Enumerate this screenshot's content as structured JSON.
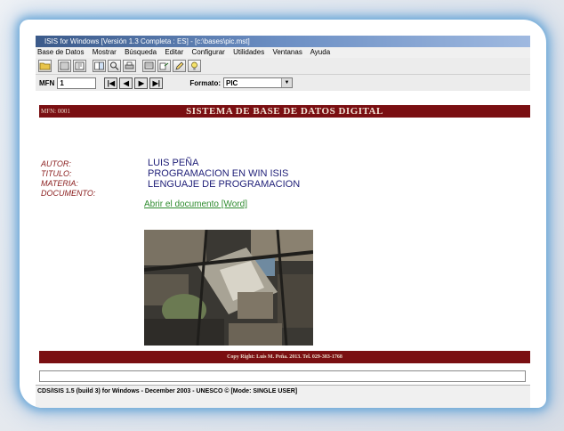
{
  "window": {
    "title": "ISIS for Windows [Versión 1.3 Completa : ES] - [c:\\bases\\pic.mst]"
  },
  "menubar": {
    "items": [
      "Base de Datos",
      "Mostrar",
      "Búsqueda",
      "Editar",
      "Configurar",
      "Utilidades",
      "Ventanas",
      "Ayuda"
    ]
  },
  "toolbar": {
    "icons": [
      "open-folder-icon",
      "database-icon",
      "index-icon",
      "browse-icon",
      "search-icon",
      "print-icon",
      "display-icon",
      "export-icon",
      "edit-pencil-icon",
      "help-bulb-icon"
    ]
  },
  "navbar": {
    "mfn_label": "MFN",
    "mfn_value": "1",
    "first_glyph": "|◀",
    "prev_glyph": "◀",
    "next_glyph": "▶",
    "last_glyph": "▶|",
    "format_label": "Formato:",
    "format_value": "PIC"
  },
  "record": {
    "banner_mfn": "MFN: 0001",
    "banner_title": "SISTEMA DE BASE DE DATOS DIGITAL",
    "fields": [
      {
        "label": "AUTOR:",
        "value": "LUIS PEÑA"
      },
      {
        "label": "TITULO:",
        "value": "PROGRAMACION EN WIN ISIS"
      },
      {
        "label": "MATERIA:",
        "value": "LENGUAJE DE PROGRAMACION"
      },
      {
        "label": "DOCUMENTO:",
        "value": ""
      }
    ],
    "doc_link": "Abrir el documento [Word]",
    "footer": "Copy Right: Luis M. Peña. 2013. Tel. 029-383-1768"
  },
  "status": {
    "text": "CDS/ISIS 1.5 (build 3) for Windows - December 2003 - UNESCO © [Mode: SINGLE USER]"
  },
  "colors": {
    "banner": "#7a0f12",
    "label": "#8a1d1d",
    "value": "#1f1f78",
    "link": "#2d8a2d"
  }
}
